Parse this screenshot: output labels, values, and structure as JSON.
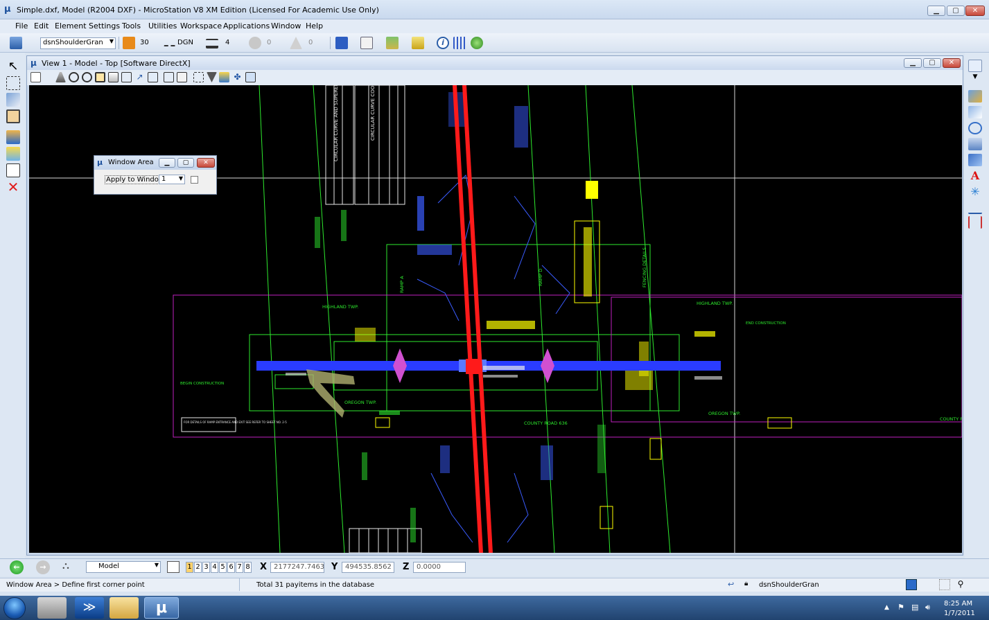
{
  "app": {
    "title": "Simple.dxf, Model (R2004 DXF) - MicroStation V8 XM Edition (Licensed For Academic Use Only)",
    "icon": "microstation-icon",
    "window_buttons": [
      "minimize-icon",
      "restore-icon",
      "close-icon"
    ]
  },
  "menu": [
    "File",
    "Edit",
    "Element",
    "Settings",
    "Tools",
    "Utilities",
    "Workspace",
    "Applications",
    "Window",
    "Help"
  ],
  "toolbar": {
    "level": "dsnShoulderGran",
    "color": "30",
    "style": "DGN",
    "weight": "4",
    "transparency": "0",
    "priority": "0"
  },
  "view": {
    "title": "View 1 - Model - Top [Software DirectX]"
  },
  "canvas_labels": {
    "highland_left": "HIGHLAND TWP.",
    "highland_right": "HIGHLAND TWP.",
    "oregon_left": "OREGON TWP.",
    "oregon_right": "OREGON TWP.",
    "county_road": "COUNTY ROAD 636",
    "county_edge": "COUNTY R",
    "fencing": "FENCING DETAILS",
    "ramp_a": "RAMP A",
    "ramp_d": "RAMP D",
    "curve_a": "CIRCULAR CURVE AND SUPERELEV",
    "curve_b": "CIRCULAR CURVE COORD",
    "note": "FOR DETAILS OF RAMP ENTRANCE AND EXIT SEE REFER TO SHEET NO. 2-5",
    "end_construction": "END CONSTRUCTION",
    "begin_construction": "BEGIN CONSTRUCTION"
  },
  "dialog": {
    "title": "Window Area",
    "apply_label": "Apply to Window:",
    "apply_value": "1"
  },
  "status": {
    "model": "Model",
    "views": [
      "1",
      "2",
      "3",
      "4",
      "5",
      "6",
      "7",
      "8"
    ],
    "active_view": "1",
    "x_label": "X",
    "x_value": "2177247.7463",
    "y_label": "Y",
    "y_value": "494535.8562",
    "z_label": "Z",
    "z_value": "0.0000",
    "prompt": "Window Area > Define first corner point",
    "message": "Total 31 payitems in the database",
    "level": "dsnShoulderGran"
  },
  "taskbar": {
    "time": "8:25 AM",
    "date": "1/7/2011"
  },
  "colors": {
    "canvas": "#000000",
    "road": "#ff1a1a",
    "crossroad": "#2a3cff",
    "green": "#2eea2e",
    "magenta": "#c020c0",
    "yellow": "#ffff00"
  }
}
